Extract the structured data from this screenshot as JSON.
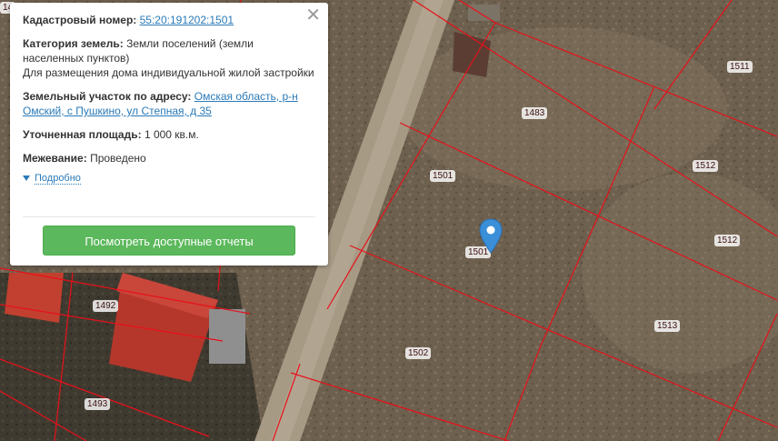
{
  "popup": {
    "close_icon": "close-icon",
    "cadastral_label": "Кадастровый номер:",
    "cadastral_value": "55:20:191202:1501",
    "category_label": "Категория земель:",
    "category_value": "Земли поселений (земли населенных пунктов)",
    "category_usage": "Для размещения дома индивидуальной жилой застройки",
    "address_label": "Земельный участок по адресу:",
    "address_value": "Омская область, р-н Омский, с Пушкино, ул Степная, д 35",
    "area_label": "Уточненная площадь:",
    "area_value": "1 000 кв.м.",
    "survey_label": "Межевание:",
    "survey_value": "Проведено",
    "details_label": "Подробно",
    "reports_button": "Посмотреть доступные отчеты"
  },
  "parcels": {
    "p1511": "1511",
    "p1483": "1483",
    "p1512a": "1512",
    "p1512b": "1512",
    "p1501a": "1501",
    "p1501b": "1501",
    "p1513": "1513",
    "p1502": "1502",
    "p1492": "1492",
    "p1493": "1493",
    "p14_partial": "14"
  },
  "colors": {
    "boundary": "#e8101a",
    "button": "#5cb85c",
    "link": "#2a7ab8",
    "marker": "#3a8fd8"
  }
}
